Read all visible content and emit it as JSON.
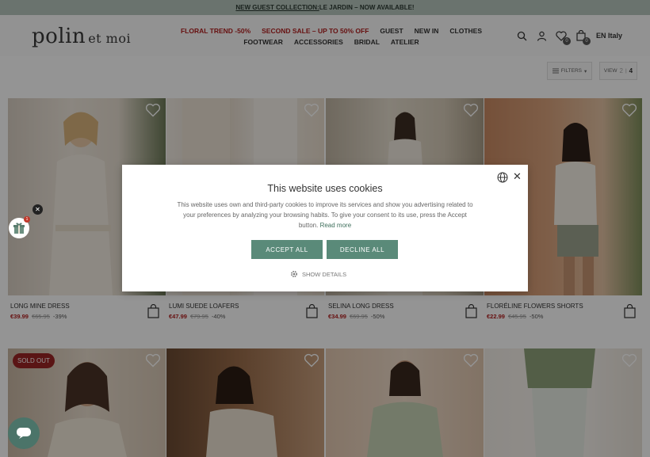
{
  "promo": {
    "link": "NEW GUEST COLLECTION:",
    "text": " LE JARDIN – NOW AVAILABLE!"
  },
  "brand": {
    "name": "polin",
    "suffix": "et moi"
  },
  "nav": [
    {
      "label": "FLORAL TREND -50%",
      "highlight": true
    },
    {
      "label": "SECOND SALE – UP TO 50% OFF",
      "highlight": true
    },
    {
      "label": "GUEST"
    },
    {
      "label": "NEW IN"
    },
    {
      "label": "CLOTHES"
    },
    {
      "label": "FOOTWEAR"
    },
    {
      "label": "ACCESSORIES"
    },
    {
      "label": "BRIDAL"
    },
    {
      "label": "ATELIER"
    }
  ],
  "header": {
    "wishlist_count": "0",
    "cart_count": "0",
    "lang": "EN",
    "country": "Italy"
  },
  "toolbar": {
    "filters": "FILTERS",
    "view_label": "VIEW",
    "view_options": [
      "2",
      "4"
    ]
  },
  "products": [
    {
      "name": "LONG MINE DRESS",
      "price": "€39.99",
      "old": "€65.95",
      "discount": "-39%"
    },
    {
      "name": "LUMI SUEDE LOAFERS",
      "price": "€47.99",
      "old": "€79.95",
      "discount": "-40%"
    },
    {
      "name": "SELINA LONG DRESS",
      "price": "€34.99",
      "old": "€69.95",
      "discount": "-50%"
    },
    {
      "name": "FLORÉLINE FLOWERS SHORTS",
      "price": "€22.99",
      "old": "€45.95",
      "discount": "-50%"
    }
  ],
  "badges": {
    "sold_out": "SOLD OUT"
  },
  "gift": {
    "count": "1"
  },
  "cookie": {
    "title": "This website uses cookies",
    "text": "This website uses own and third-party cookies to improve its services and show you advertising related to your preferences by analyzing your browsing habits. To give your consent to its use, press the Accept button.",
    "read_more": "Read more",
    "accept": "ACCEPT ALL",
    "decline": "DECLINE ALL",
    "details": "SHOW DETAILS"
  },
  "colors": {
    "accent": "#5a8a79",
    "sale": "#b21e1e",
    "promo_bar": "#b7c7bd"
  }
}
